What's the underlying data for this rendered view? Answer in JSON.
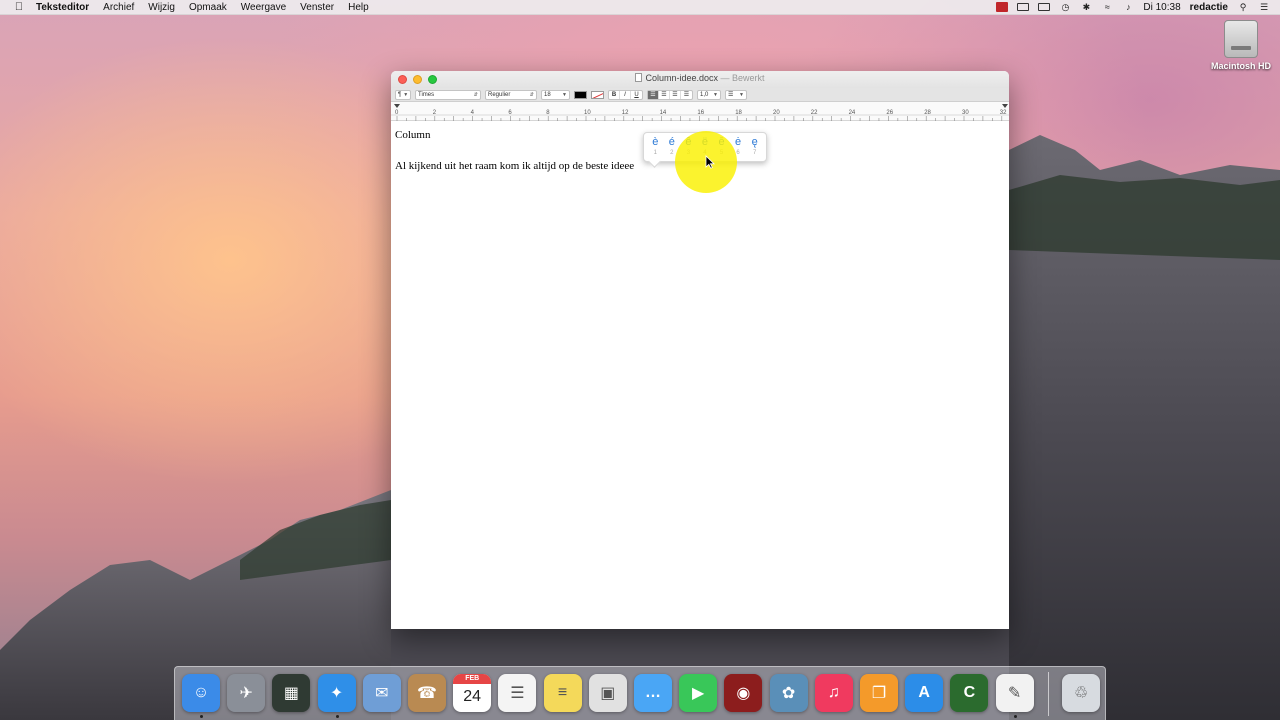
{
  "menubar": {
    "app_name": "Teksteditor",
    "items": [
      "Archief",
      "Wijzig",
      "Opmaak",
      "Weergave",
      "Venster",
      "Help"
    ],
    "clock": "Di 10:38",
    "user": "redactie"
  },
  "desktop": {
    "drive_label": "Macintosh HD"
  },
  "window": {
    "filename": "Column-idee.docx",
    "title_suffix": "— Bewerkt",
    "toolbar": {
      "paragraph_style": "¶",
      "font_family": "Times",
      "font_style": "Regulier",
      "font_size": "18",
      "bold": "B",
      "italic": "I",
      "underline": "U",
      "line_spacing": "1,0"
    },
    "ruler_labels": [
      "0",
      "2",
      "4",
      "6",
      "8",
      "10",
      "12",
      "14",
      "16",
      "18",
      "20",
      "22",
      "24",
      "26",
      "28",
      "30",
      "32"
    ],
    "document": {
      "line1": "Column",
      "line2": "Al kijkend uit het raam kom ik altijd op de beste ideee"
    },
    "accent_popup": {
      "options": [
        {
          "char": "è",
          "num": "1"
        },
        {
          "char": "é",
          "num": "2"
        },
        {
          "char": "ê",
          "num": "3"
        },
        {
          "char": "ë",
          "num": "4"
        },
        {
          "char": "ē",
          "num": "5"
        },
        {
          "char": "ė",
          "num": "6"
        },
        {
          "char": "ę",
          "num": "7"
        }
      ]
    }
  },
  "dock": {
    "calendar_month": "FEB",
    "calendar_day": "24",
    "apps": [
      {
        "icon": "finder-icon",
        "color": "#3b8be8"
      },
      {
        "icon": "launchpad-icon",
        "color": "#8a8f98"
      },
      {
        "icon": "mission-control-icon",
        "color": "#2f3a33"
      },
      {
        "icon": "safari-icon",
        "color": "#2f8fe8"
      },
      {
        "icon": "mail-icon",
        "color": "#6f9ed6"
      },
      {
        "icon": "contacts-icon",
        "color": "#b98a52"
      },
      {
        "icon": "calendar-icon",
        "color": "#ffffff"
      },
      {
        "icon": "reminders-icon",
        "color": "#f4f4f4"
      },
      {
        "icon": "notes-icon",
        "color": "#f4d95a"
      },
      {
        "icon": "preview-icon",
        "color": "#e1e1e1"
      },
      {
        "icon": "messages-icon",
        "color": "#4aa6f5"
      },
      {
        "icon": "facetime-icon",
        "color": "#39c759"
      },
      {
        "icon": "photo-booth-icon",
        "color": "#8c1d1d"
      },
      {
        "icon": "iphoto-icon",
        "color": "#5a8fb8"
      },
      {
        "icon": "itunes-icon",
        "color": "#f03a5f"
      },
      {
        "icon": "ibooks-icon",
        "color": "#f49a2a"
      },
      {
        "icon": "app-store-icon",
        "color": "#2c8de8"
      },
      {
        "icon": "camtasia-icon",
        "color": "#2b6b2e"
      },
      {
        "icon": "textedit-icon",
        "color": "#f2f2f2"
      },
      {
        "icon": "trash-icon",
        "color": "#d7dbe0"
      }
    ]
  }
}
